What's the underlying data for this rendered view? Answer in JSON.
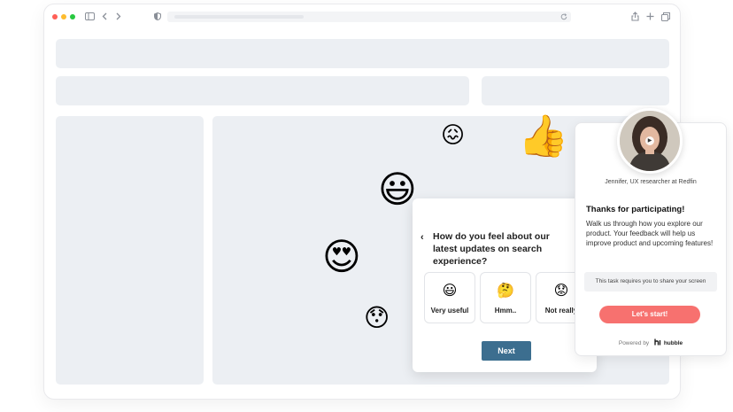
{
  "survey": {
    "back_icon": "chevron-left-icon",
    "question": "How do you feel about our latest updates on search experience?",
    "options": [
      {
        "emoji": "😃",
        "label": "Very useful"
      },
      {
        "emoji": "🤔",
        "label": "Hmm.."
      },
      {
        "emoji": "😟",
        "label": "Not really"
      }
    ],
    "next_label": "Next",
    "accent": "#3c6e8f"
  },
  "panel": {
    "role": "Jennifer, UX researcher at Redfin",
    "title": "Thanks for participating!",
    "body": "Walk us through how you explore our product. Your feedback will help us improve product and upcoming features!",
    "note": "This task requires you to share your screen",
    "start_label": "Let's start!",
    "powered_by": "Powered by",
    "brand": "hubble",
    "start_color": "#f7716f"
  },
  "floating_emojis": [
    "😖",
    "👍",
    "😃",
    "😍",
    "😯"
  ]
}
